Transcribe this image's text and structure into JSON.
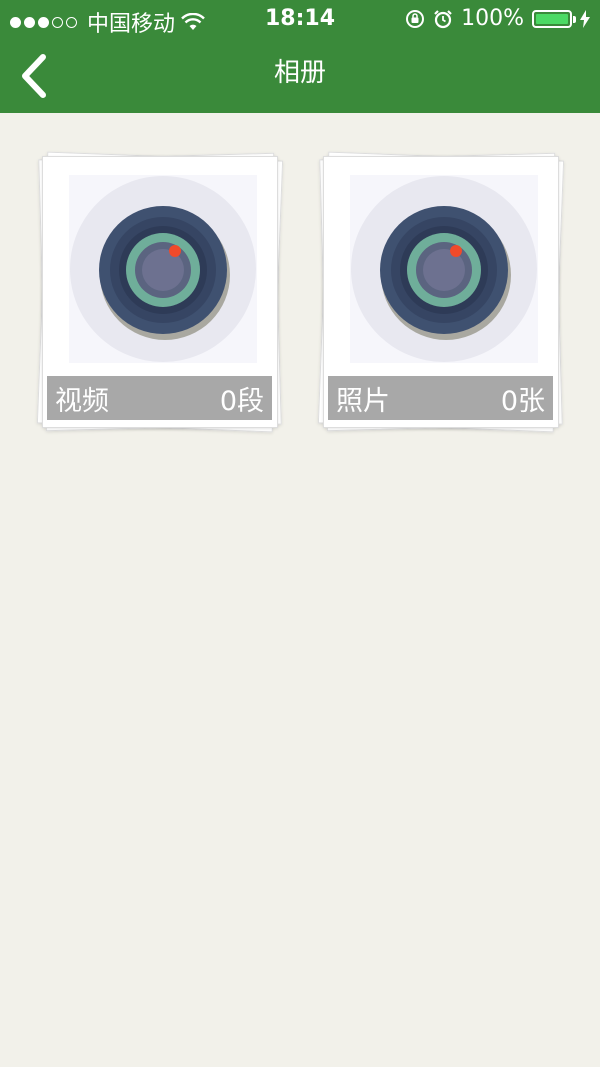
{
  "status_bar": {
    "carrier": "中国移动",
    "time": "18:14",
    "battery_percent": "100%",
    "battery_level": 1.0,
    "icons": [
      "signal-dots-icon",
      "wifi-icon",
      "rotation-lock-icon",
      "alarm-icon",
      "battery-icon",
      "charging-icon"
    ]
  },
  "nav": {
    "title": "相册",
    "back_icon": "chevron-left-icon"
  },
  "albums": [
    {
      "label": "视频",
      "count": "0段",
      "icon": "camera-lens-icon"
    },
    {
      "label": "照片",
      "count": "0张",
      "icon": "camera-lens-icon"
    }
  ],
  "colors": {
    "header_bg": "#3a8a3a",
    "page_bg": "#f2f1ea",
    "caption_bg": "#a8a8a8",
    "battery_fill": "#4cd964",
    "lens_dot": "#f04a2a"
  }
}
